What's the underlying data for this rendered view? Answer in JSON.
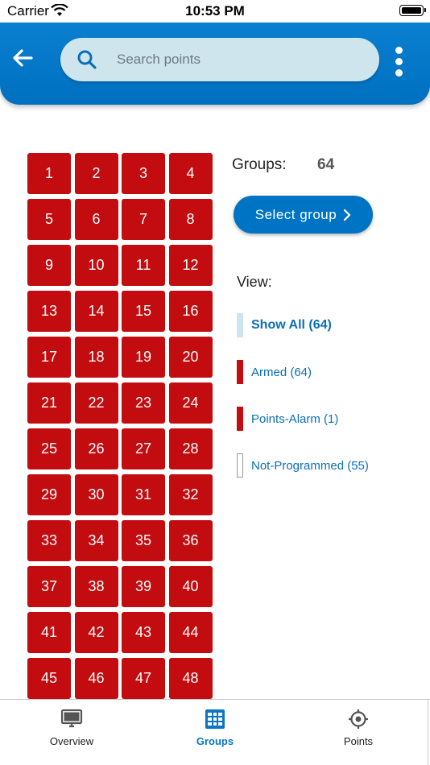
{
  "status_bar": {
    "carrier": "Carrier",
    "time": "10:53 PM"
  },
  "header": {
    "search": {
      "placeholder": "Search points",
      "value": ""
    },
    "icons": [
      "back-arrow-icon",
      "search-icon",
      "more-vertical-icon"
    ]
  },
  "grid": {
    "cells": [
      "1",
      "2",
      "3",
      "4",
      "5",
      "6",
      "7",
      "8",
      "9",
      "10",
      "11",
      "12",
      "13",
      "14",
      "15",
      "16",
      "17",
      "18",
      "19",
      "20",
      "21",
      "22",
      "23",
      "24",
      "25",
      "26",
      "27",
      "28",
      "29",
      "30",
      "31",
      "32",
      "33",
      "34",
      "35",
      "36",
      "37",
      "38",
      "39",
      "40",
      "41",
      "42",
      "43",
      "44",
      "45",
      "46",
      "47",
      "48"
    ],
    "cell_color": "#c20c10"
  },
  "panel": {
    "groups_label": "Groups:",
    "groups_count": "64",
    "select_button": "Select group",
    "view_label": "View:",
    "legend": [
      {
        "label": "Show All (64)",
        "color": "#cfe5ee",
        "style": "bold"
      },
      {
        "label": "Armed (64)",
        "color": "#c20c10",
        "style": "normal"
      },
      {
        "label": "Points-Alarm (1)",
        "color": "#c20c10",
        "style": "normal"
      },
      {
        "label": "Not-Programmed (55)",
        "color": "#ffffff",
        "style": "outline"
      }
    ]
  },
  "tabbar": {
    "tabs": [
      {
        "label": "Overview",
        "icon": "monitor-icon",
        "active": false
      },
      {
        "label": "Groups",
        "icon": "grid-icon",
        "active": true
      },
      {
        "label": "Points",
        "icon": "target-icon",
        "active": false
      }
    ],
    "accent": "#0a75c6"
  }
}
